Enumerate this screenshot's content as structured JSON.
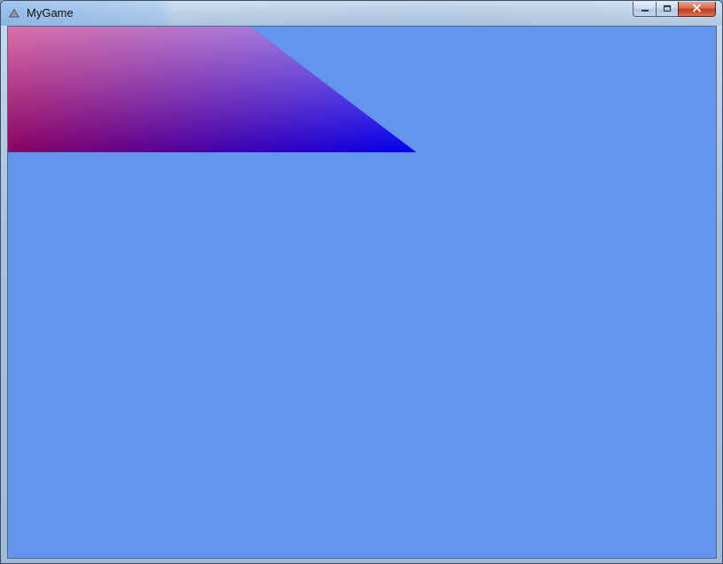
{
  "window": {
    "title": "MyGame"
  },
  "icons": {
    "app": "app-icon",
    "minimize": "minimize-icon",
    "maximize": "maximize-icon",
    "close": "close-icon"
  },
  "colors": {
    "clear_color": "#6495ed",
    "vertex_top_left": "#d870a8",
    "vertex_top_right": "#8a80f8",
    "vertex_bottom_left": "#8a0060",
    "vertex_bottom_right": "#0000f0"
  }
}
